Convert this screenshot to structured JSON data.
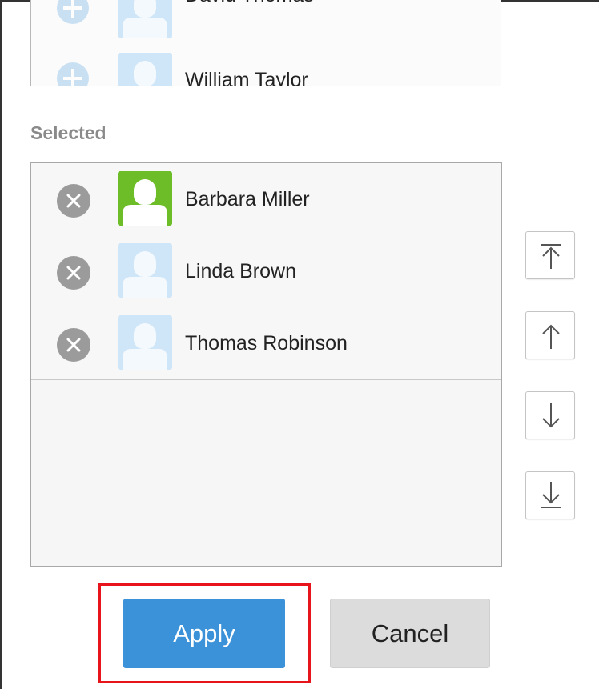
{
  "candidates": {
    "items": [
      {
        "name": "David Thomas",
        "icon": "user-avatar-icon"
      },
      {
        "name": "William Taylor",
        "icon": "user-avatar-icon"
      }
    ]
  },
  "selected": {
    "label": "Selected",
    "items": [
      {
        "name": "Barbara Miller",
        "avatar_color": "#6dbd28"
      },
      {
        "name": "Linda Brown",
        "avatar_color": "#cfe6f8"
      },
      {
        "name": "Thomas Robinson",
        "avatar_color": "#cfe6f8"
      }
    ]
  },
  "order_buttons": [
    "move-to-top-icon",
    "move-up-icon",
    "move-down-icon",
    "move-to-bottom-icon"
  ],
  "actions": {
    "apply_label": "Apply",
    "cancel_label": "Cancel"
  },
  "colors": {
    "apply": "#3c92d8",
    "highlight": "#e8141c"
  }
}
